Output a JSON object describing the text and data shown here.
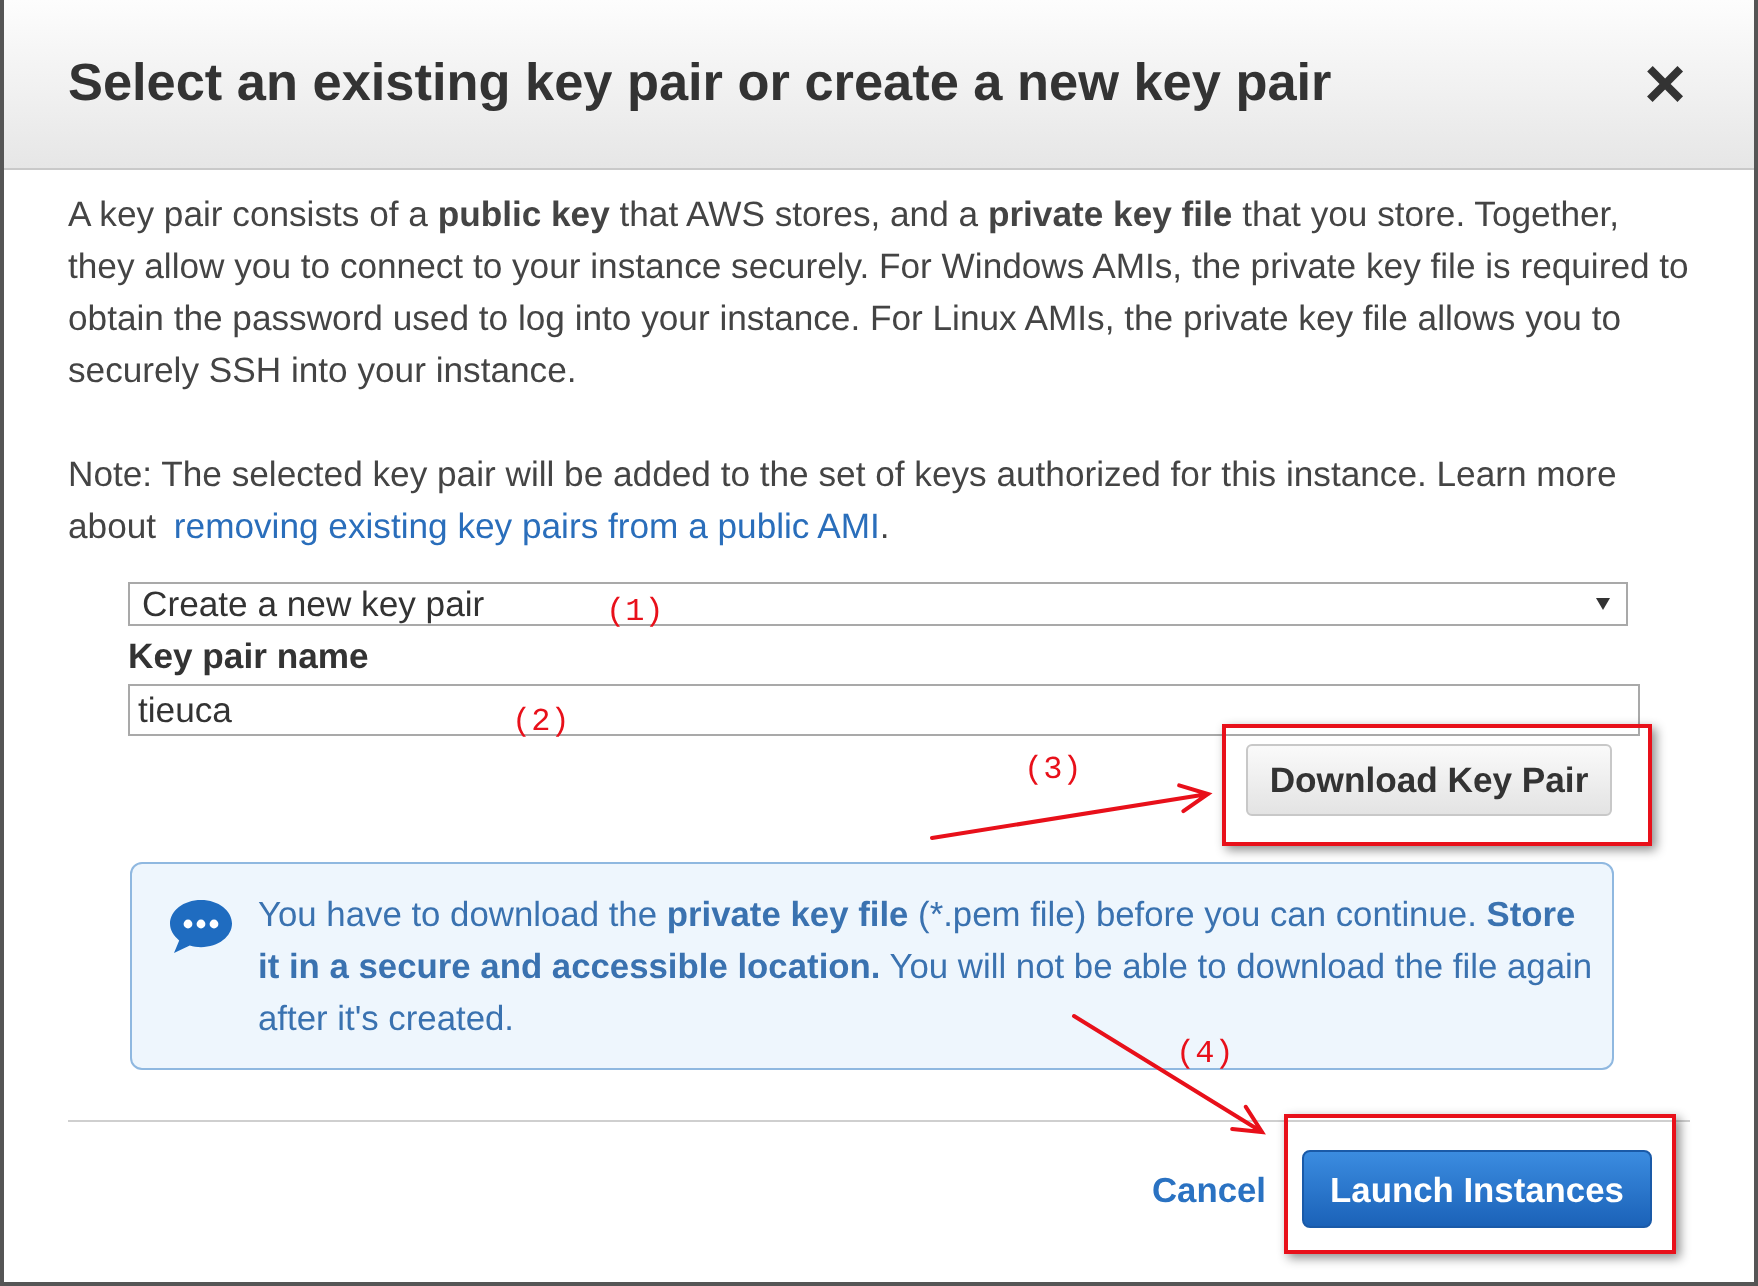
{
  "dialog": {
    "title": "Select an existing key pair or create a new key pair",
    "close": "×"
  },
  "intro": "A key pair consists of a **public key** that AWS stores, and a **private key file** that you store. Together, they allow you to connect to your instance securely. For Windows AMIs, the private key file is required to obtain the password used to log into your instance. For Linux AMIs, the private key file allows you to securely SSH into your instance.",
  "note": {
    "text": "Note: The selected key pair will be added to the set of keys authorized for this instance. Learn more about",
    "link": "removing existing key pairs from a public AMI",
    "after": "."
  },
  "key_pair_select": {
    "value": "Create a new key pair"
  },
  "key_pair_name": {
    "label": "Key pair name",
    "value": "tieuca"
  },
  "download_button": "Download Key Pair",
  "info": {
    "text": "You have to download the **private key file** (*.pem file) before you can continue. **Store it in a secure and accessible location.** You will not be able to download the file again after it's created."
  },
  "footer": {
    "cancel": "Cancel",
    "primary": "Launch Instances"
  },
  "annotations": [
    {
      "kind": "marker",
      "label": "(1)"
    },
    {
      "kind": "marker",
      "label": "(2)"
    },
    {
      "kind": "callout",
      "label": "(3)"
    },
    {
      "kind": "callout",
      "label": "(4)"
    }
  ]
}
